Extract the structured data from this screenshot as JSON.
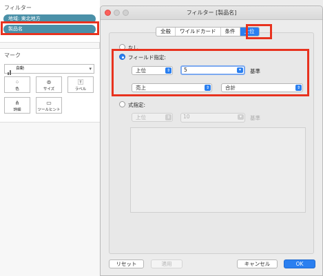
{
  "left_panel": {
    "filters_title": "フィルター",
    "filter_pills": [
      "地域: 東北地方",
      "製品名"
    ],
    "marks_title": "マーク",
    "mark_type": "自動",
    "mark_buttons": [
      "色",
      "サイズ",
      "ラベル",
      "詳細",
      "ツールヒント"
    ]
  },
  "dialog": {
    "title": "フィルター [製品名]",
    "tabs": [
      "全般",
      "ワイルドカード",
      "条件",
      "上位"
    ],
    "active_tab": "上位",
    "options": {
      "none_label": "なし",
      "by_field_label": "フィールド指定:",
      "by_formula_label": "式指定:"
    },
    "by_field": {
      "direction": "上位",
      "count": "5",
      "basis_label": "基準",
      "field": "売上",
      "aggregation": "合計"
    },
    "by_formula": {
      "direction": "上位",
      "count": "10",
      "basis_label": "基準"
    },
    "buttons": {
      "reset": "リセット",
      "apply": "適用",
      "cancel": "キャンセル",
      "ok": "OK"
    }
  },
  "colors": {
    "accent": "#2a7ff0",
    "highlight": "#e8321e",
    "pill": "#4a90a8"
  }
}
